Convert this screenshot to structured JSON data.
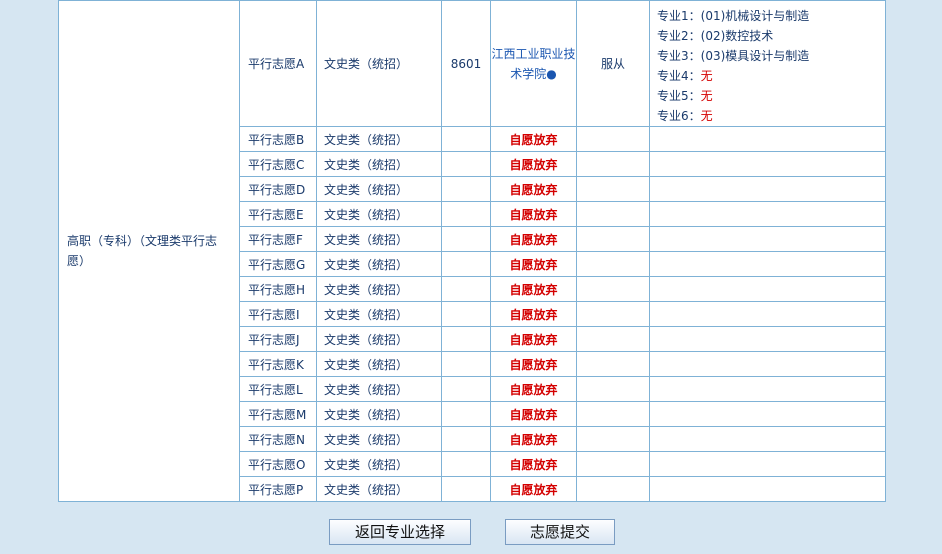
{
  "batch_label": "高职（专科）（文理类平行志愿）",
  "row_a": {
    "pick": "平行志愿A",
    "category": "文史类（统招）",
    "code": "8601",
    "college": "江西工业职业技术学院●",
    "obey": "服从",
    "majors": [
      {
        "label": "专业1：",
        "value": "(01)机械设计与制造",
        "is_none": false
      },
      {
        "label": "专业2：",
        "value": "(02)数控技术",
        "is_none": false
      },
      {
        "label": "专业3：",
        "value": "(03)模具设计与制造",
        "is_none": false
      },
      {
        "label": "专业4：",
        "value": "无",
        "is_none": true
      },
      {
        "label": "专业5：",
        "value": "无",
        "is_none": true
      },
      {
        "label": "专业6：",
        "value": "无",
        "is_none": true
      }
    ]
  },
  "other_rows": [
    {
      "pick": "平行志愿B",
      "category": "文史类（统招）",
      "status": "自愿放弃"
    },
    {
      "pick": "平行志愿C",
      "category": "文史类（统招）",
      "status": "自愿放弃"
    },
    {
      "pick": "平行志愿D",
      "category": "文史类（统招）",
      "status": "自愿放弃"
    },
    {
      "pick": "平行志愿E",
      "category": "文史类（统招）",
      "status": "自愿放弃"
    },
    {
      "pick": "平行志愿F",
      "category": "文史类（统招）",
      "status": "自愿放弃"
    },
    {
      "pick": "平行志愿G",
      "category": "文史类（统招）",
      "status": "自愿放弃"
    },
    {
      "pick": "平行志愿H",
      "category": "文史类（统招）",
      "status": "自愿放弃"
    },
    {
      "pick": "平行志愿I",
      "category": "文史类（统招）",
      "status": "自愿放弃"
    },
    {
      "pick": "平行志愿J",
      "category": "文史类（统招）",
      "status": "自愿放弃"
    },
    {
      "pick": "平行志愿K",
      "category": "文史类（统招）",
      "status": "自愿放弃"
    },
    {
      "pick": "平行志愿L",
      "category": "文史类（统招）",
      "status": "自愿放弃"
    },
    {
      "pick": "平行志愿M",
      "category": "文史类（统招）",
      "status": "自愿放弃"
    },
    {
      "pick": "平行志愿N",
      "category": "文史类（统招）",
      "status": "自愿放弃"
    },
    {
      "pick": "平行志愿O",
      "category": "文史类（统招）",
      "status": "自愿放弃"
    },
    {
      "pick": "平行志愿P",
      "category": "文史类（统招）",
      "status": "自愿放弃"
    }
  ],
  "buttons": {
    "back": "返回专业选择",
    "submit": "志愿提交"
  },
  "colors": {
    "page_bg": "#d6e6f2",
    "border": "#7fb2d6",
    "text": "#1a3a6b",
    "abandon": "#d40000"
  }
}
